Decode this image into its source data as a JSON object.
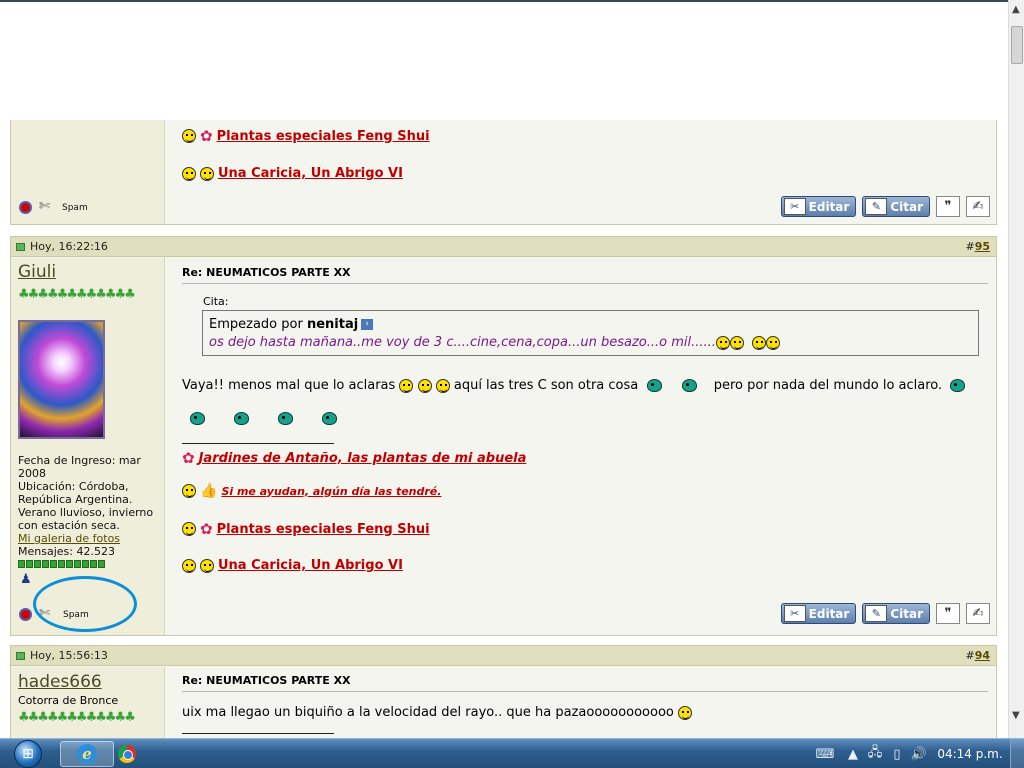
{
  "post_prev": {
    "sig_links": [
      {
        "icon": "flower-smiley-icon",
        "text": "Plantas especiales Feng Shui"
      },
      {
        "icon": "double-smiley-icon",
        "text": "Una Caricia, Un Abrigo VI"
      }
    ],
    "spam_label": "Spam",
    "buttons": {
      "edit": "Editar",
      "quote": "Citar"
    }
  },
  "post_95": {
    "timestamp": "Hoy, 16:22:16",
    "number_prefix": "#",
    "number": "95",
    "username": "Giuli",
    "user_info": {
      "joined": "Fecha de Ingreso: mar 2008",
      "location": "Ubicación: Córdoba, República Argentina. Verano lluvioso, invierno con estación seca.",
      "gallery_link": "Mi galeria de fotos",
      "messages": "Mensajes: 42.523"
    },
    "title": "Re: NEUMATICOS PARTE XX",
    "quote": {
      "label": "Cita:",
      "started_by_prefix": "Empezado por",
      "author": "nenitaj",
      "text": "os dejo hasta mañana..me voy de 3 c....cine,cena,copa...un besazo...o mil......"
    },
    "message_parts": [
      "Vaya!! menos mal que lo aclaras",
      "aquí las tres C son otra cosa",
      "pero por nada del mundo lo aclaro."
    ],
    "sig_links": [
      {
        "icon": "flower-icon",
        "text": "Jardines de Antaño, las plantas de mi abuela"
      },
      {
        "icon": "thumbs-up-smiley-icon",
        "text": "Si me ayudan, algún día las tendré."
      },
      {
        "icon": "flower-smiley-icon",
        "text": "Plantas especiales Feng Shui"
      },
      {
        "icon": "double-smiley-icon",
        "text": "Una Caricia, Un Abrigo VI"
      }
    ],
    "spam_label": "Spam",
    "buttons": {
      "edit": "Editar",
      "quote": "Citar"
    }
  },
  "post_94": {
    "timestamp": "Hoy, 15:56:13",
    "number_prefix": "#",
    "number": "94",
    "username": "hades666",
    "user_title": "Cotorra de Bronce",
    "title": "Re: NEUMATICOS PARTE XX",
    "message": "uix ma llegao un biquiño a la velocidad del rayo.. que ha pazaooooooooooo"
  },
  "taskbar": {
    "clock": "04:14 p.m.",
    "start_icon": "windows-orb-icon",
    "apps": [
      "internet-explorer-icon",
      "chrome-icon"
    ]
  },
  "colors": {
    "link_red": "#c00000",
    "header_bg": "#dfdfbe",
    "quote_text": "#7a1a8a",
    "annotation_circle": "#0c8fd6"
  }
}
